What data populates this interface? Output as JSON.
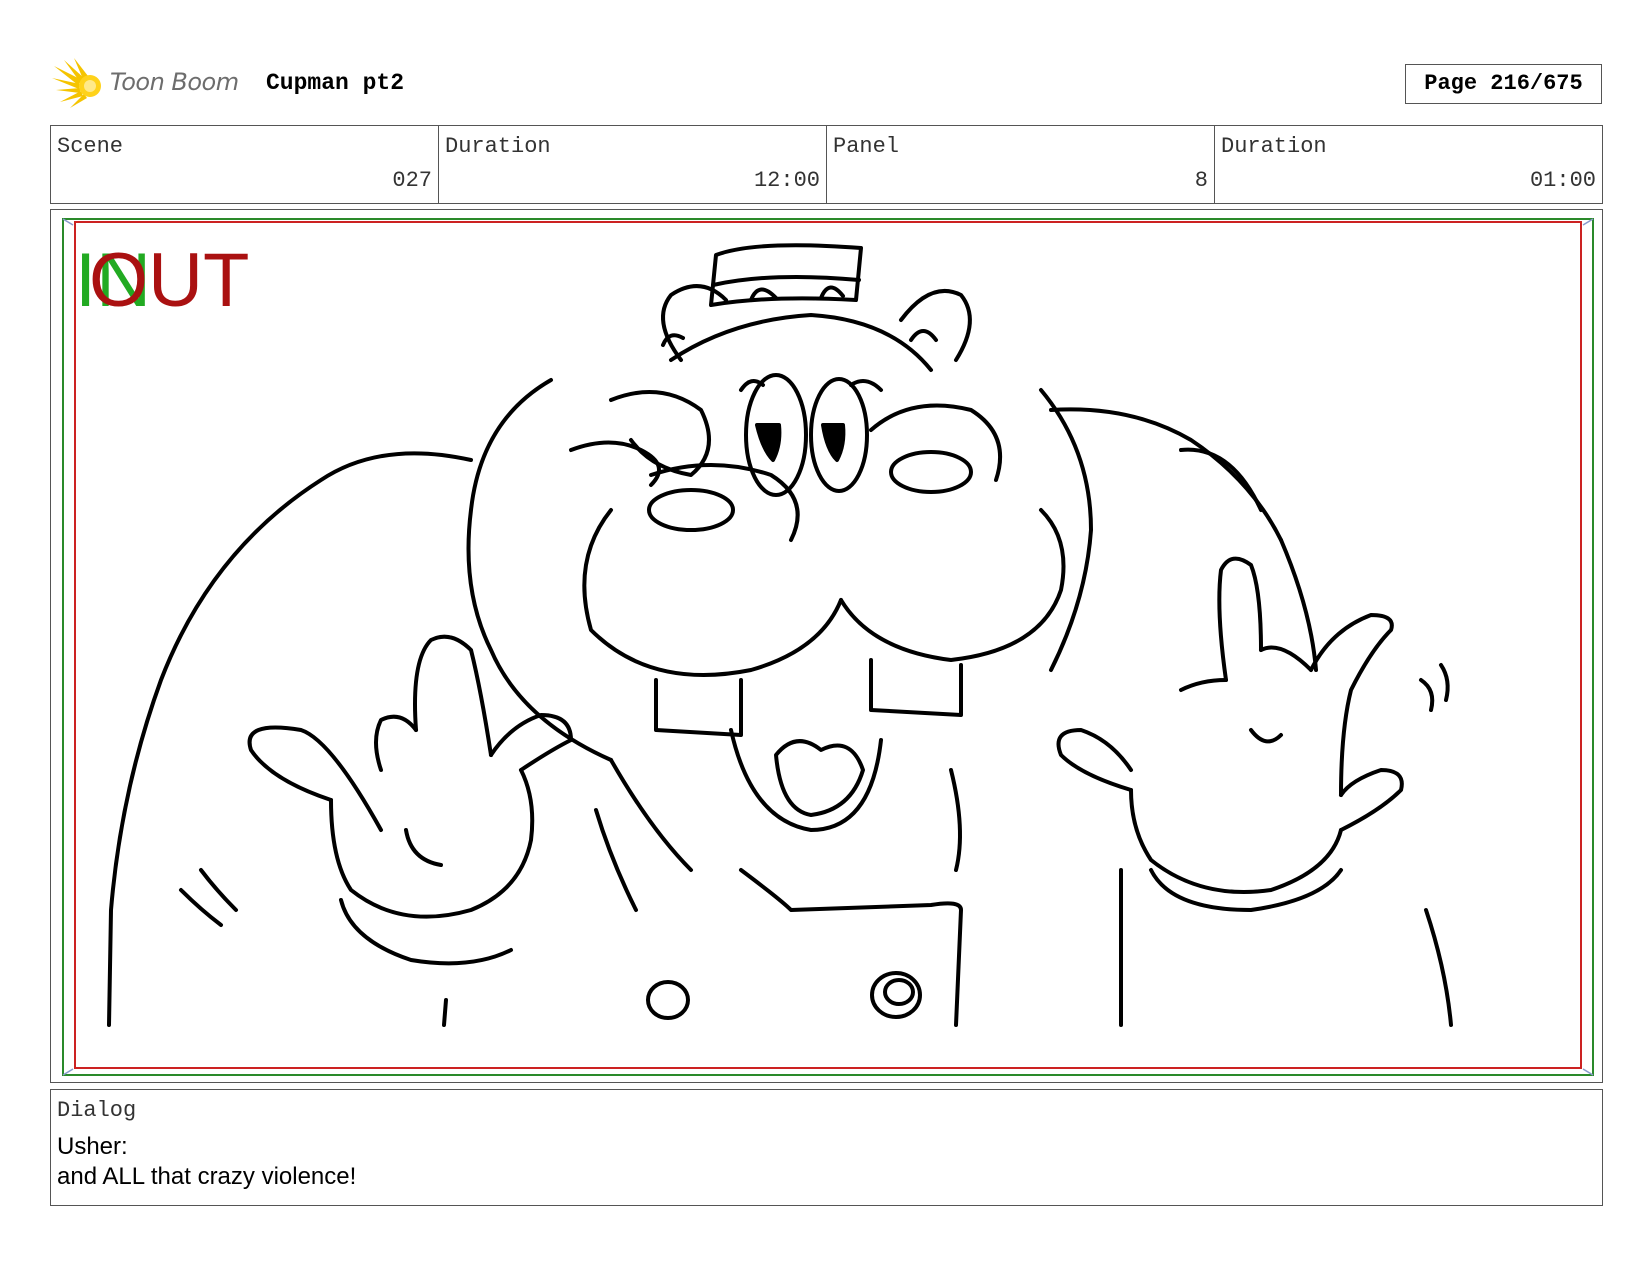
{
  "header": {
    "logo_text": "Toon Boom",
    "project_title": "Cupman pt2",
    "page_label": "Page 216/675"
  },
  "info": [
    {
      "label": "Scene",
      "value": "027"
    },
    {
      "label": "Duration",
      "value": "12:00"
    },
    {
      "label": "Panel",
      "value": "8"
    },
    {
      "label": "Duration",
      "value": "01:00"
    }
  ],
  "panel": {
    "in_marker": "IN",
    "out_marker": "OUT",
    "in_color": "#22aa22",
    "out_color": "#aa1111",
    "frame_green": "#2a8a2a",
    "frame_red": "#cc2222"
  },
  "dialog": {
    "label": "Dialog",
    "speaker": "Usher:",
    "line": "and ALL that crazy violence!"
  }
}
